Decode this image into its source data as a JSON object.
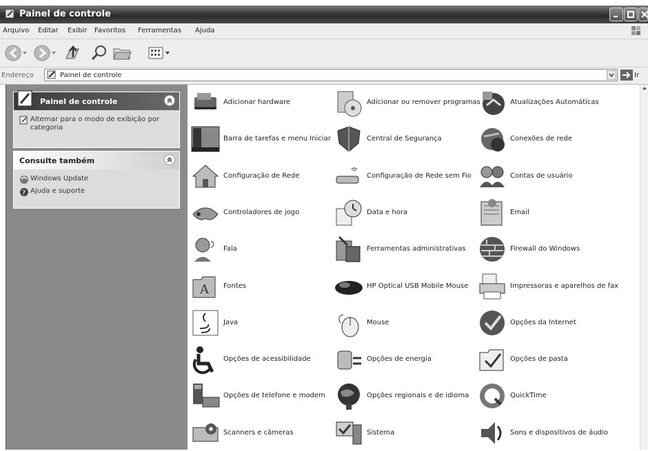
{
  "window": {
    "title": "Painel de controle"
  },
  "menu": [
    "Arquivo",
    "Editar",
    "Exibir",
    "Favoritos",
    "Ferramentas",
    "Ajuda"
  ],
  "address": {
    "label": "Endereço",
    "value": "Painel de controle",
    "go": "Ir"
  },
  "tasks": {
    "title": "Painel de controle",
    "switch_view": "Alternar para o modo de exibição por categoria"
  },
  "see_also": {
    "title": "Consulte também",
    "items": [
      "Windows Update",
      "Ajuda e suporte"
    ]
  },
  "items": [
    {
      "label": "Adicionar hardware",
      "icon": "hardware-icon"
    },
    {
      "label": "Adicionar ou remover programas",
      "icon": "add-remove-programs-icon"
    },
    {
      "label": "Atualizações Automáticas",
      "icon": "automatic-updates-icon"
    },
    {
      "label": "Barra de tarefas e menu Iniciar",
      "icon": "taskbar-icon"
    },
    {
      "label": "Central de Segurança",
      "icon": "security-center-icon"
    },
    {
      "label": "Conexões de rede",
      "icon": "network-connections-icon"
    },
    {
      "label": "Configuração de Rede",
      "icon": "network-setup-icon"
    },
    {
      "label": "Configuração de Rede sem Fio",
      "icon": "wireless-setup-icon"
    },
    {
      "label": "Contas de usuário",
      "icon": "user-accounts-icon"
    },
    {
      "label": "Controladores de jogo",
      "icon": "game-controllers-icon"
    },
    {
      "label": "Data e hora",
      "icon": "date-time-icon"
    },
    {
      "label": "Email",
      "icon": "email-icon"
    },
    {
      "label": "Fala",
      "icon": "speech-icon"
    },
    {
      "label": "Ferramentas administrativas",
      "icon": "admin-tools-icon"
    },
    {
      "label": "Firewall do Windows",
      "icon": "firewall-icon"
    },
    {
      "label": "Fontes",
      "icon": "fonts-icon"
    },
    {
      "label": "HP Optical USB Mobile Mouse",
      "icon": "hp-mouse-icon"
    },
    {
      "label": "Impressoras e aparelhos de fax",
      "icon": "printers-icon"
    },
    {
      "label": "Java",
      "icon": "java-icon"
    },
    {
      "label": "Mouse",
      "icon": "mouse-icon"
    },
    {
      "label": "Opções da Internet",
      "icon": "internet-options-icon"
    },
    {
      "label": "Opções de acessibilidade",
      "icon": "accessibility-icon"
    },
    {
      "label": "Opções de energia",
      "icon": "power-options-icon"
    },
    {
      "label": "Opções de pasta",
      "icon": "folder-options-icon"
    },
    {
      "label": "Opções de telefone e modem",
      "icon": "phone-modem-icon"
    },
    {
      "label": "Opções regionais e de idioma",
      "icon": "regional-icon"
    },
    {
      "label": "QuickTime",
      "icon": "quicktime-icon"
    },
    {
      "label": "Scanners e câmeras",
      "icon": "scanners-icon"
    },
    {
      "label": "Sistema",
      "icon": "system-icon"
    },
    {
      "label": "Sons e dispositivos de áudio",
      "icon": "sounds-icon"
    }
  ]
}
